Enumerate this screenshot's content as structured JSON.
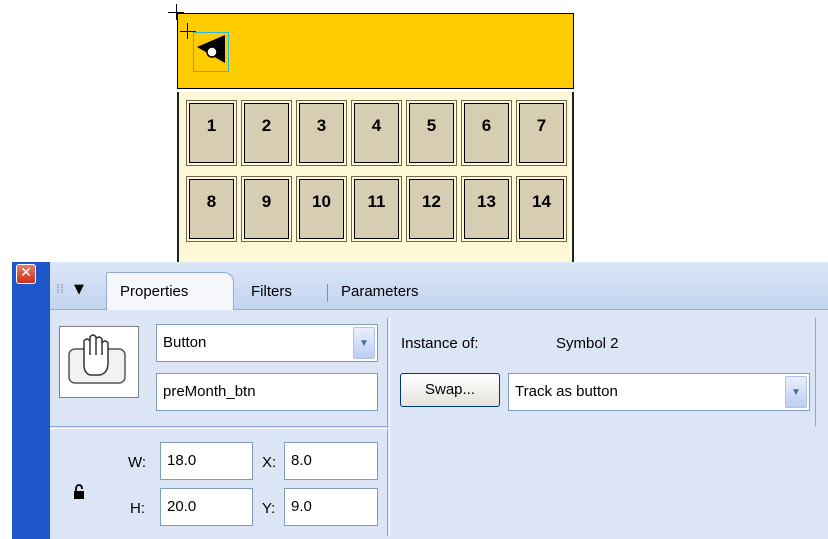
{
  "stage": {
    "days": [
      "1",
      "2",
      "3",
      "4",
      "5",
      "6",
      "7",
      "8",
      "9",
      "10",
      "11",
      "12",
      "13",
      "14"
    ],
    "colors": {
      "header": "#ffcc00",
      "grid_background": "#fff8d6",
      "day_fill": "#d6cdb3"
    }
  },
  "panel": {
    "close_icon": "close-icon",
    "tabs": {
      "properties": "Properties",
      "filters": "Filters",
      "parameters": "Parameters"
    },
    "symbol_behavior": "Button",
    "instance_name": "preMonth_btn",
    "instance_of_label": "Instance of:",
    "instance_of_value": "Symbol 2",
    "swap_label": "Swap...",
    "tracking": "Track as button",
    "w_label": "W:",
    "w_value": "18.0",
    "h_label": "H:",
    "h_value": "20.0",
    "x_label": "X:",
    "x_value": "8.0",
    "y_label": "Y:",
    "y_value": "9.0",
    "colors": {
      "accent": "#1c56c8",
      "close": "#c8331c",
      "panel_bg": "#dbe5f6"
    }
  }
}
